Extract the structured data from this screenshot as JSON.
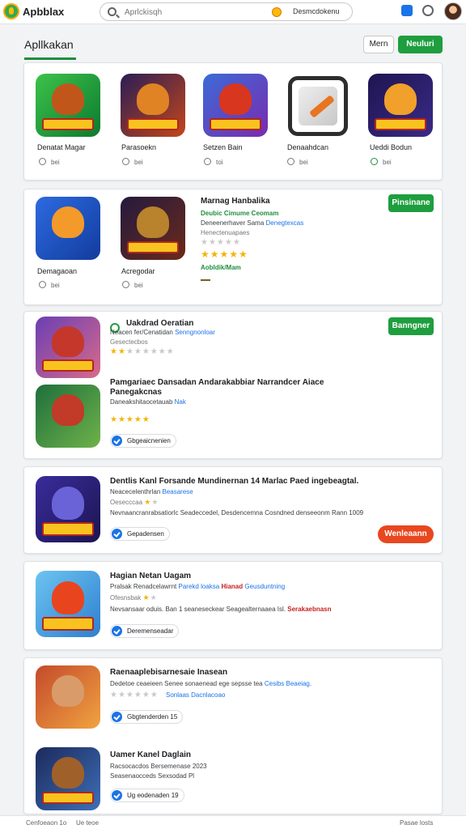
{
  "header": {
    "brand": "Apbblax",
    "search_placeholder": "Aprlckisqh",
    "search_chip": "Desmcdokenu"
  },
  "section": {
    "title": "Apllkakan",
    "button_outline": "Mern",
    "button_green": "Neuluri"
  },
  "top_apps": [
    {
      "name": "Denatat Magar",
      "meta": "bei",
      "check": false
    },
    {
      "name": "Parasoekn",
      "meta": "bei",
      "check": false
    },
    {
      "name": "Setzen Bain",
      "meta": "toi",
      "check": false
    },
    {
      "name": "Denaahdcan",
      "meta": "bei",
      "check": false
    },
    {
      "name": "Ueddi Bodun",
      "meta": "bei",
      "check": true
    }
  ],
  "card2": {
    "apps": [
      {
        "name": "Demagaoan",
        "meta": "bei"
      },
      {
        "name": "Acregodar",
        "meta": "bei"
      }
    ],
    "title": "Marnag Hanbalika",
    "line1": "Deubic Cimume Ceomam",
    "line2a": "Deneenerhaver Sama",
    "line2b": "Denegtexcas",
    "line3": "Henectenuapaes",
    "rating_text": "Aobldik/Mam",
    "button": "Pinsinane",
    "stars_faded": 5,
    "stars": 5
  },
  "card3": {
    "r1_title": "Uakdrad Oeratian",
    "r1_line1a": "Neacen fer/Cenatidan",
    "r1_line1b": "Senngnonloar",
    "r1_line2": "Gesectecbos",
    "r1_stars": 2,
    "button": "Banngner",
    "r2_title": "Pamgariaec Dansadan Andarakabbiar Narrandcer Aiace",
    "r2_title2": "Panegakcnas",
    "r2_line1a": "Daneakshitaocetauab",
    "r2_line1b": "Nak",
    "r2_stars": 5,
    "chip": "Gbgeaicnenien"
  },
  "card4": {
    "title": "Dentlis Kanl Forsande Mundinernan 14 Marlac Paed ingebeagtal.",
    "line1a": "Neacecelenthrlan",
    "line1b": "Beasarese",
    "line2": "Oesecccaa",
    "line3": "Nevnaancranrabsatiorlc Seadeccedel, Desdencemna Cosndned denseeonm Rann 1009",
    "stars": 1,
    "chip": "Gepadensen",
    "button": "Wenleaann"
  },
  "card5": {
    "title": "Hagian Netan Uagam",
    "line1a": "Pralsak Renadcelawrnt",
    "line1b": "Parekd loaksa",
    "line1c": "Hianad",
    "line1d": "Geusduntning",
    "line2": "Ofesnsbak",
    "line3a": "Nevsansaar oduis. Ban 1 seaneseckear Seagealternaaea Isl.",
    "line3b": "Serakaebnasn",
    "stars": 1,
    "chip": "Deremenseadar"
  },
  "card6": {
    "r1_title": "Raenaaplebisarnesaie Inasean",
    "r1_line1a": "Dedetoe ceaeieen Senee sonaenead ege sepsse tea",
    "r1_line1b": "Cesibs Beaeiag.",
    "r1_line2": "Sonlaas Dacnlacoao",
    "r1_stars_faded": 6,
    "r1_chip": "Gbgtenderden 15",
    "r2_title": "Uamer Kanel Daglain",
    "r2_line1": "Racsocacdos Bersemenase 2023",
    "r2_line2": "Seasenaocceds Sexsodad Pl",
    "r2_chip": "Ug eodenaden 19"
  },
  "footer": {
    "left": "Cenfoeaon 1o",
    "mid": "Ue teoe",
    "right": "Pasae losts"
  },
  "colors": {
    "accent_green": "#1e9e3e",
    "star": "#f4b400",
    "cta_orange": "#e8471f",
    "link_blue": "#1a73e8"
  }
}
